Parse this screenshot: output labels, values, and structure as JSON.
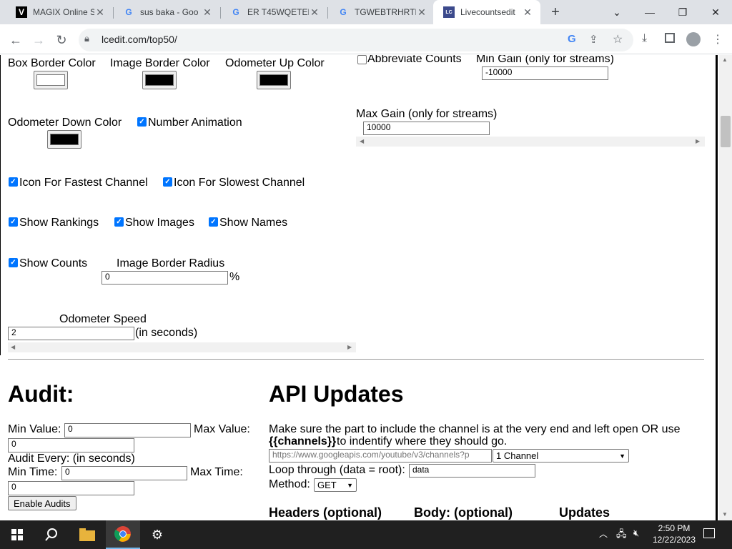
{
  "browser": {
    "tabs": [
      {
        "title": "MAGIX Online S",
        "favicon": "V",
        "active": false
      },
      {
        "title": "sus baka - Goo",
        "favicon": "G",
        "active": false
      },
      {
        "title": "ER T45WQETER",
        "favicon": "G",
        "active": false
      },
      {
        "title": "TGWEBTRHRTB",
        "favicon": "G",
        "active": false
      },
      {
        "title": "Livecountsedit",
        "favicon": "LC",
        "active": true
      }
    ],
    "url": "lcedit.com/top50/"
  },
  "settings": {
    "box_border_color": "Box Border Color",
    "image_border_color": "Image Border Color",
    "odometer_up_color": "Odometer Up Color",
    "odometer_down_color": "Odometer Down Color",
    "number_animation": "Number Animation",
    "icon_fastest": "Icon For Fastest Channel",
    "icon_slowest": "Icon For Slowest Channel",
    "show_rankings": "Show Rankings",
    "show_images": "Show Images",
    "show_names": "Show Names",
    "show_counts": "Show Counts",
    "image_border_radius": "Image Border Radius",
    "image_border_radius_value": "0",
    "percent": "%",
    "odometer_speed": "Odometer Speed",
    "odometer_speed_value": "2",
    "in_seconds": "(in seconds)",
    "abbreviate_counts": "Abbreviate Counts",
    "min_gain": "Min Gain (only for streams)",
    "min_gain_value": "-10000",
    "max_gain": "Max Gain (only for streams)",
    "max_gain_value": "10000"
  },
  "colors": {
    "box_border": "#ffffff",
    "image_border": "#000000",
    "odometer_up": "#000000",
    "odometer_down": "#000000",
    "checkbox_accent": "#0075ff"
  },
  "audit": {
    "heading": "Audit:",
    "min_value_label": "Min Value:",
    "min_value": "0",
    "max_value_label": "Max Value:",
    "max_value": "0",
    "audit_every": "Audit Every: (in seconds)",
    "min_time_label": "Min Time:",
    "min_time": "0",
    "max_time_label": "Max Time:",
    "max_time": "0",
    "enable_button": "Enable Audits"
  },
  "api": {
    "heading": "API Updates",
    "instructions_1": "Make sure the part to include the channel is at the very end and left open OR use",
    "channels_token": "{{channels}}",
    "instructions_2": " to indentify where they should go.",
    "url_value": "https://www.googleapis.com/youtube/v3/channels?p",
    "channel_select": "1 Channel",
    "loop_label": "Loop through (data = root):",
    "loop_value": "data",
    "method_label": "Method:",
    "method_value": "GET",
    "headers_heading": "Headers (optional)",
    "body_heading": "Body: (optional)",
    "updates_heading": "Updates"
  },
  "taskbar": {
    "time": "2:50 PM",
    "date": "12/22/2023"
  }
}
